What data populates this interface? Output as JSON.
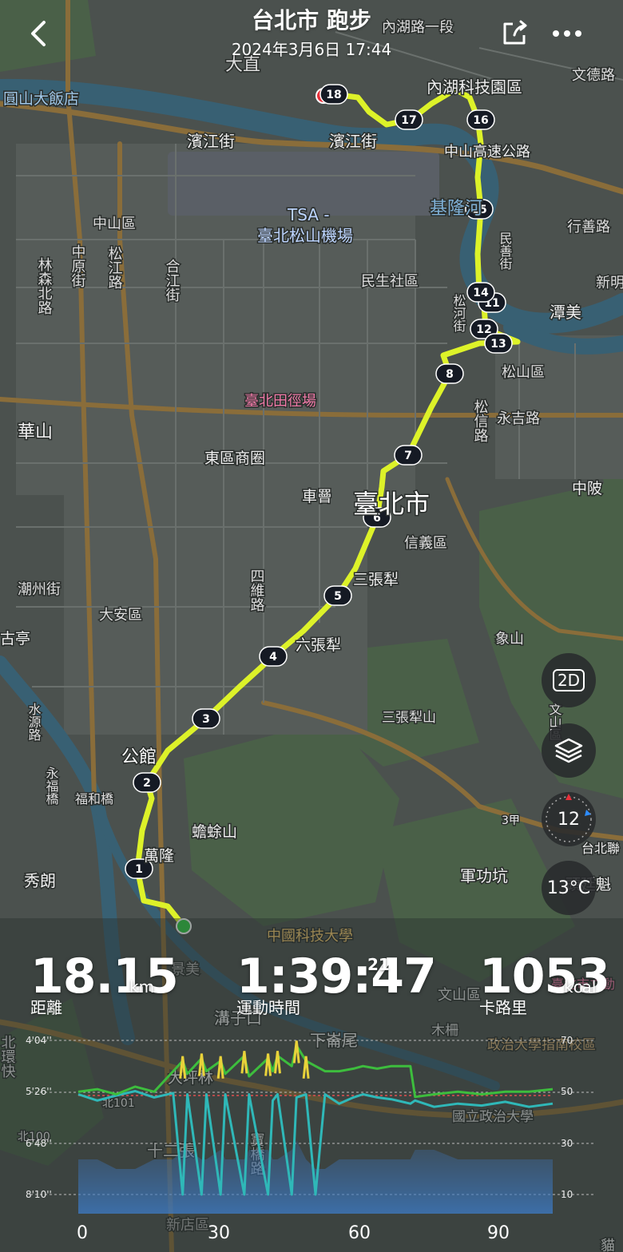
{
  "header": {
    "title": "台北市 跑步",
    "datetime": "2024年3月6日 17:44",
    "back_icon": "chevron-left-icon",
    "share_icon": "share-icon",
    "more_icon": "more-dots-icon"
  },
  "map": {
    "route_color": "#ddf229",
    "start_color": "#2ecc40",
    "end_color": "#e8303a",
    "km_markers": [
      "1",
      "2",
      "3",
      "4",
      "5",
      "6",
      "7",
      "8",
      "11",
      "12",
      "13",
      "14",
      "15",
      "16",
      "17",
      "18"
    ],
    "labels": [
      "大直",
      "內湖路一段",
      "文德路",
      "圓山大飯店",
      "內湖科技園區",
      "濱江街",
      "濱江街",
      "中山高速公路",
      "TSA -",
      "臺北松山機場",
      "基隆河",
      "中山區",
      "林森北路",
      "中原街",
      "松江路",
      "合江街",
      "民生社區",
      "民善街",
      "行善路",
      "新明",
      "潭美",
      "松河街",
      "松山區",
      "臺北田徑場",
      "華山",
      "松信路",
      "永吉路",
      "東區商圈",
      "車罾",
      "臺北市",
      "中陂",
      "信義區",
      "三張犁",
      "四維路",
      "潮州街",
      "大安區",
      "六張犁",
      "古亭",
      "象山",
      "三張犁山",
      "水源路",
      "文山區",
      "公館",
      "永福橋",
      "福和橋",
      "蟾蜍山",
      "萬隆",
      "秀朗",
      "軍功坑",
      "頭廷魁",
      "台北聯",
      "中國科技大學",
      "景美",
      "臺北市立動",
      "文山區",
      "溝子口",
      "木柵",
      "北環快",
      "下崙尾",
      "政治大學指南校區",
      "大坪林",
      "北101",
      "寶橋路",
      "國立政治大學",
      "北100",
      "十二張",
      "新店區",
      "貓",
      "3甲"
    ]
  },
  "controls": {
    "view_mode": "2D",
    "layers_icon": "layers-icon",
    "zoom_level": "12",
    "temperature": "13°C"
  },
  "stats": {
    "distance": {
      "value": "18.15",
      "unit": "km",
      "label": "距離"
    },
    "duration": {
      "value": "1:39:47",
      "fraction": "21",
      "label": "運動時間"
    },
    "calories": {
      "value": "1053",
      "unit": "kcal",
      "label": "卡路里"
    }
  },
  "chart_data": {
    "type": "line",
    "x_ticks": [
      "0",
      "30",
      "60",
      "90"
    ],
    "y_left_ticks": [
      "4'04''",
      "5'26''",
      "6'48''",
      "8'10''"
    ],
    "y_right_ticks": [
      "70",
      "50",
      "30",
      "10"
    ],
    "xlim": [
      0,
      100
    ],
    "x": [
      0,
      4,
      8,
      12,
      16,
      20,
      22,
      23,
      26,
      27,
      30,
      31,
      35,
      36,
      40,
      41,
      42,
      45,
      46,
      48,
      50,
      52,
      55,
      58,
      60,
      63,
      66,
      70,
      71,
      75,
      80,
      85,
      90,
      95,
      100
    ],
    "series": [
      {
        "values_pace_sec": [
          330,
          340,
          332,
          325,
          335,
          328,
          490,
          330,
          490,
          330,
          490,
          330,
          490,
          330,
          490,
          340,
          330,
          490,
          335,
          330,
          490,
          330,
          345,
          335,
          330,
          335,
          338,
          345,
          340,
          350,
          345,
          348,
          342,
          350,
          345
        ]
      },
      {
        "values_hr": [
          50,
          51,
          49,
          52,
          50,
          58,
          62,
          57,
          63,
          58,
          62,
          57,
          64,
          56,
          63,
          58,
          64,
          60,
          68,
          62,
          60,
          58,
          58,
          59,
          60,
          59,
          60,
          60,
          48,
          49,
          50,
          49,
          50,
          50,
          51
        ]
      }
    ],
    "elevation_m": [
      12,
      12,
      11,
      11,
      12,
      12,
      13,
      13,
      12,
      12,
      13,
      12,
      12,
      13,
      13,
      12,
      12,
      13,
      14,
      12,
      11,
      11,
      12,
      12,
      12,
      12,
      12,
      12,
      13,
      13,
      12,
      12,
      12,
      12,
      12
    ],
    "average_pace_sec": 330
  }
}
